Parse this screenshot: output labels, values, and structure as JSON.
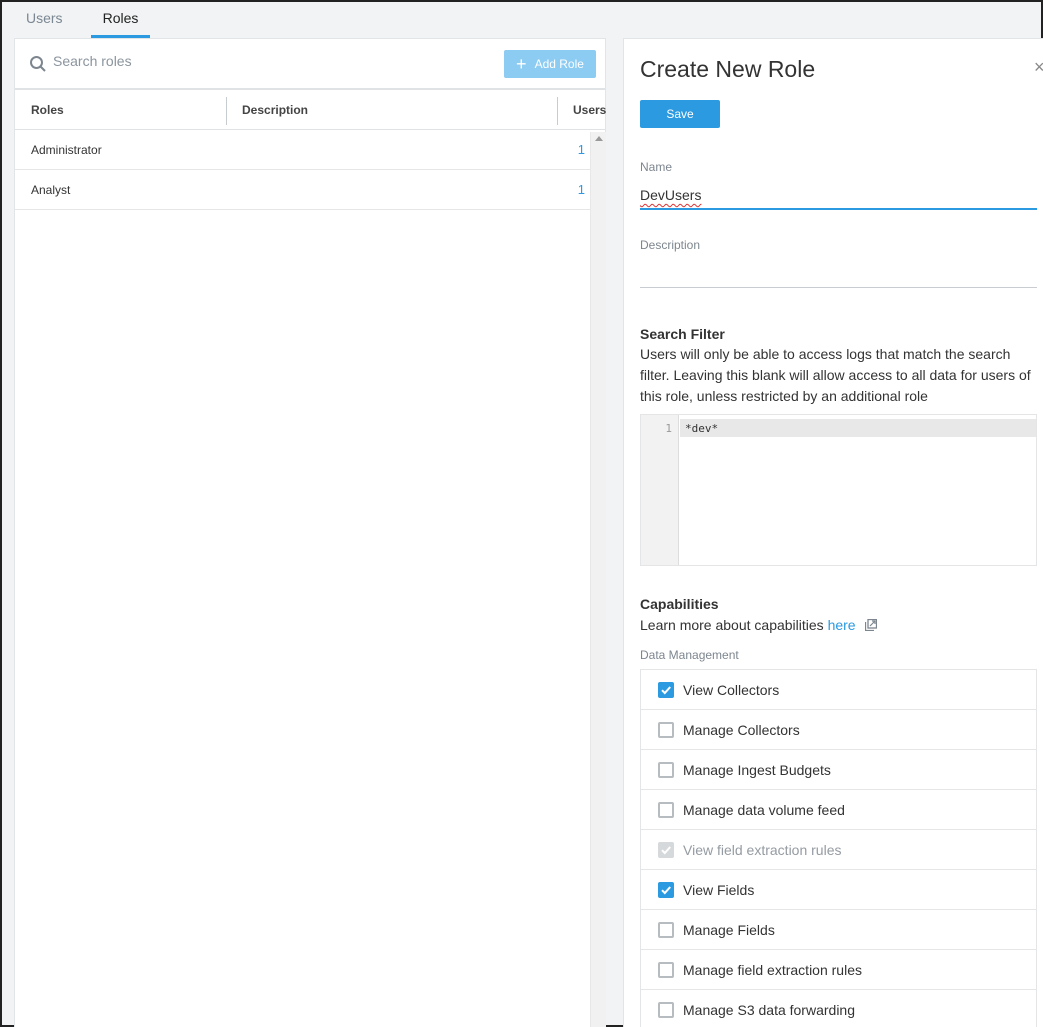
{
  "tabs": [
    {
      "label": "Users",
      "active": false
    },
    {
      "label": "Roles",
      "active": true
    }
  ],
  "roles_list": {
    "search_placeholder": "Search roles",
    "add_button_label": "Add Role",
    "columns": [
      "Roles",
      "Description",
      "Users"
    ],
    "rows": [
      {
        "name": "Administrator",
        "description": "",
        "users": "1"
      },
      {
        "name": "Analyst",
        "description": "",
        "users": "1"
      }
    ]
  },
  "form": {
    "title": "Create New Role",
    "close_label": "×",
    "save_label": "Save",
    "name_label": "Name",
    "name_value": "DevUsers",
    "description_label": "Description",
    "description_value": "",
    "search_filter_title": "Search Filter",
    "search_filter_help": "Users will only be able to access logs that match the search filter. Leaving this blank will allow access to all data for users of this role, unless restricted by an additional role",
    "editor_line_number": "1",
    "editor_code": "*dev*",
    "capabilities_title": "Capabilities",
    "capabilities_help_prefix": "Learn more about capabilities",
    "capabilities_help_link": "here",
    "capabilities_group": "Data Management",
    "capabilities": [
      {
        "label": "View Collectors",
        "state": "checked"
      },
      {
        "label": "Manage Collectors",
        "state": "unchecked"
      },
      {
        "label": "Manage Ingest Budgets",
        "state": "unchecked"
      },
      {
        "label": "Manage data volume feed",
        "state": "unchecked"
      },
      {
        "label": "View field extraction rules",
        "state": "disabled-checked"
      },
      {
        "label": "View Fields",
        "state": "checked"
      },
      {
        "label": "Manage Fields",
        "state": "unchecked"
      },
      {
        "label": "Manage field extraction rules",
        "state": "unchecked"
      },
      {
        "label": "Manage S3 data forwarding",
        "state": "unchecked"
      }
    ]
  },
  "colors": {
    "accent": "#2b9ae0",
    "accent_light": "#8ccbf2",
    "error_underline": "#d33"
  }
}
